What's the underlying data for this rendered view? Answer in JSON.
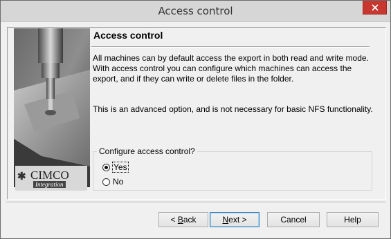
{
  "window": {
    "title": "Access control"
  },
  "sidebar_image": {
    "logo_text": "CIMCO",
    "logo_subtext": "Integration"
  },
  "page": {
    "title": "Access control",
    "description": "All machines can by default access the export in both read and write mode. With access control you can configure which machines can access the export, and if they can write or delete files in the folder.",
    "note": "This is an advanced option, and is not necessary for basic NFS functionality."
  },
  "group": {
    "legend": "Configure access control?",
    "options": [
      {
        "label": "Yes",
        "checked": true
      },
      {
        "label": "No",
        "checked": false
      }
    ]
  },
  "buttons": {
    "back": {
      "prefix": "< ",
      "mnemonic": "B",
      "rest": "ack"
    },
    "next": {
      "mnemonic": "N",
      "rest": "ext >"
    },
    "cancel": "Cancel",
    "help": "Help"
  },
  "colors": {
    "close_button": "#c7372f",
    "titlebar": "#d6d6d6",
    "dialog_bg": "#f0f0f0"
  }
}
